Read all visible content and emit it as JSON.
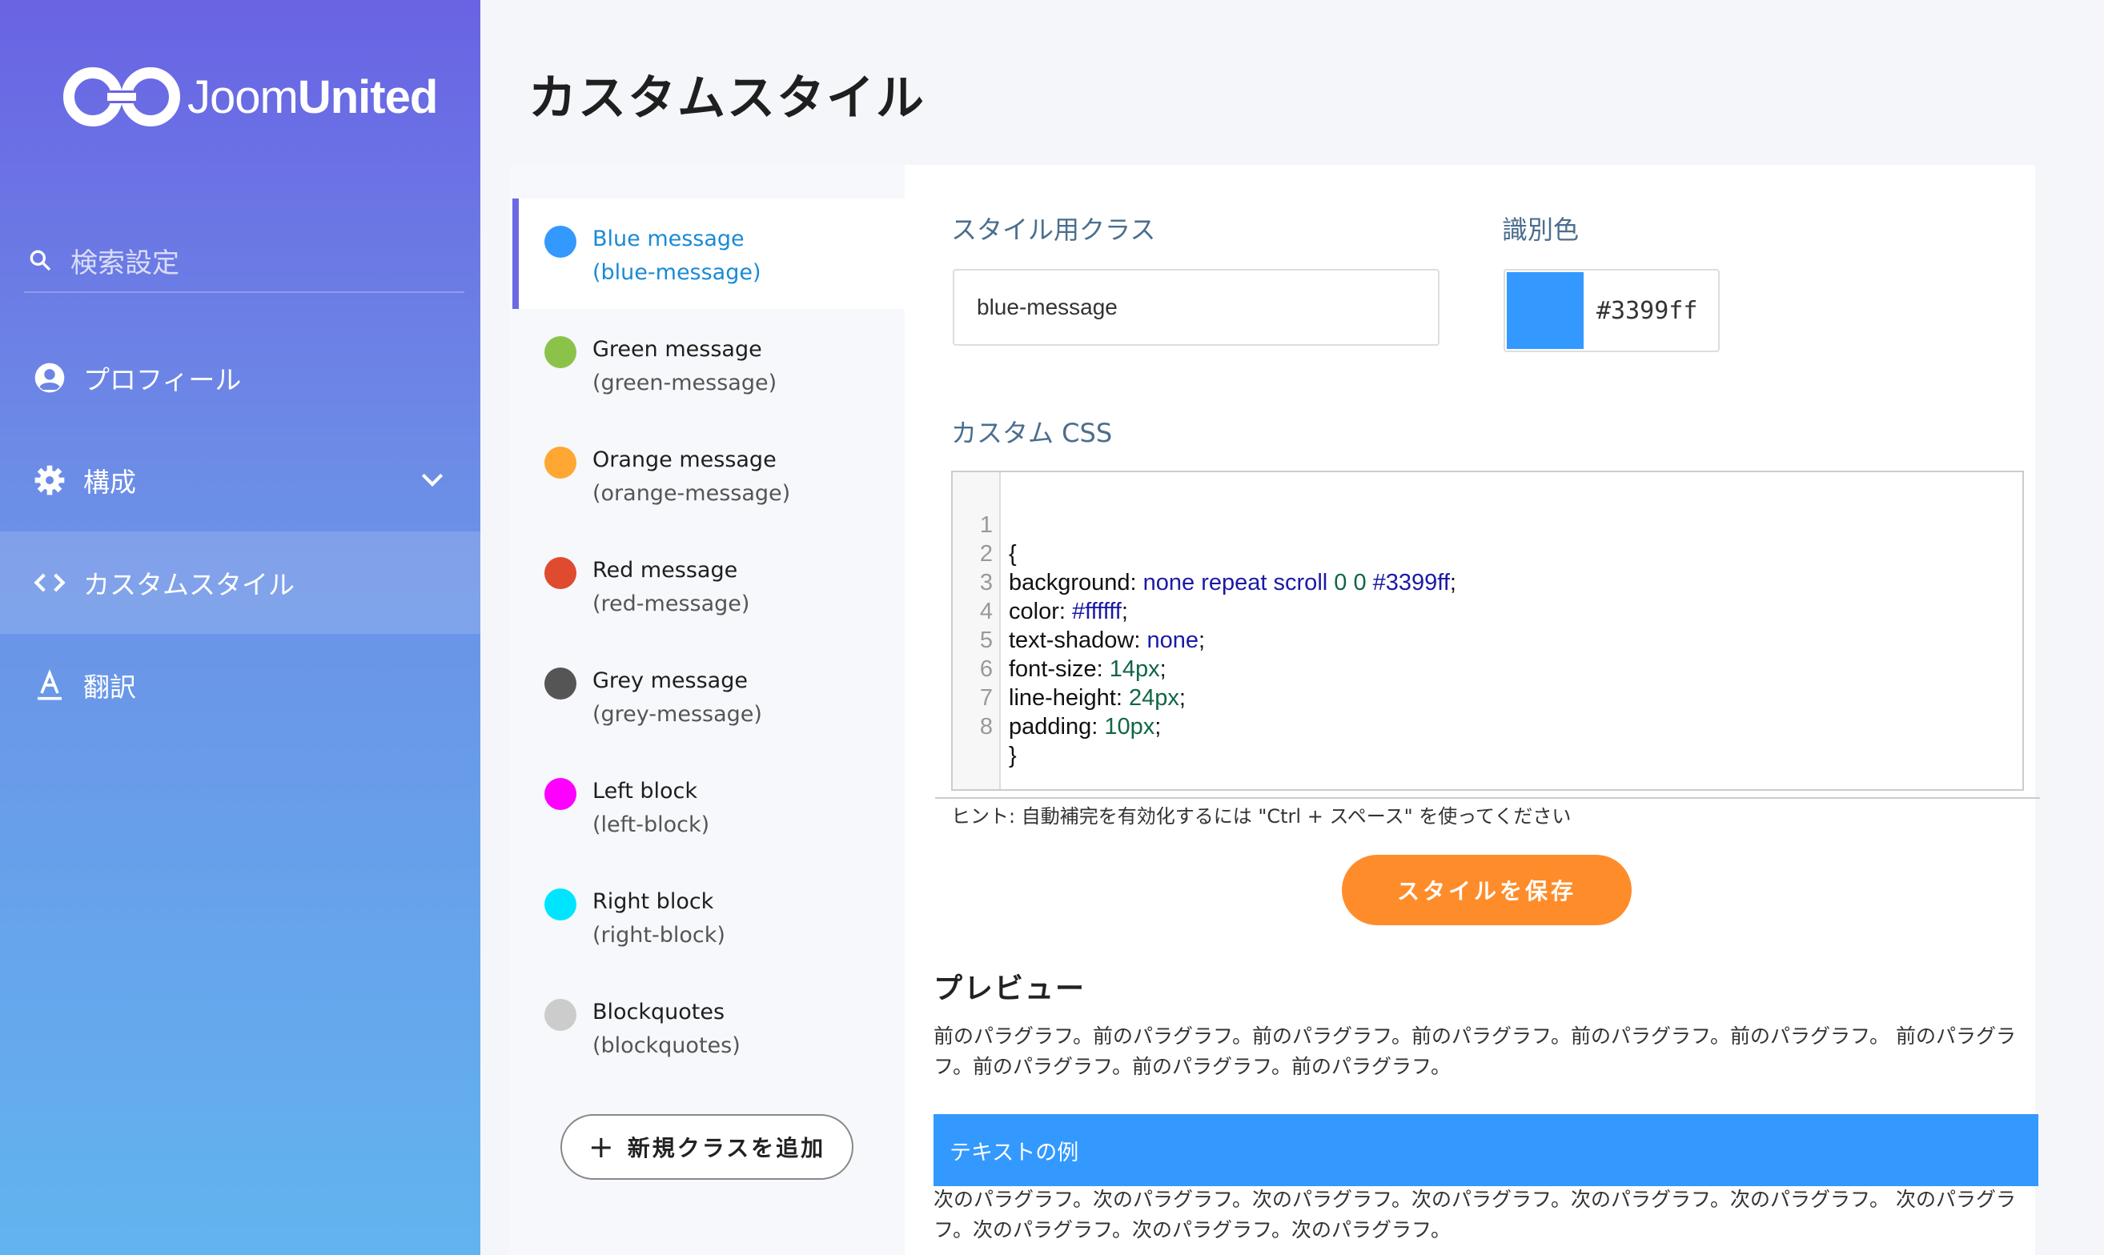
{
  "sidebar": {
    "logo": {
      "text_light": "Joom",
      "text_bold": "United"
    },
    "search_label": "検索設定",
    "items": [
      {
        "label": "プロフィール",
        "icon": "user-circle-icon"
      },
      {
        "label": "構成",
        "icon": "gear-icon"
      },
      {
        "label": "カスタムスタイル",
        "icon": "code-icon"
      },
      {
        "label": "翻訳",
        "icon": "translate-icon"
      }
    ]
  },
  "page_title": "カスタムスタイル",
  "styles_list": {
    "items": [
      {
        "name": "Blue message",
        "class": "(blue-message)",
        "color": "#3399ff"
      },
      {
        "name": "Green message",
        "class": "(green-message)",
        "color": "#8bc34a"
      },
      {
        "name": "Orange message",
        "class": "(orange-message)",
        "color": "#ffa733"
      },
      {
        "name": "Red message",
        "class": "(red-message)",
        "color": "#e04a2f"
      },
      {
        "name": "Grey message",
        "class": "(grey-message)",
        "color": "#555555"
      },
      {
        "name": "Left block",
        "class": "(left-block)",
        "color": "#ff00ff"
      },
      {
        "name": "Right block",
        "class": "(right-block)",
        "color": "#00e5ff"
      },
      {
        "name": "Blockquotes",
        "class": "(blockquotes)",
        "color": "#cccccc"
      }
    ],
    "add_button_plus": "+",
    "add_button_label": "新規クラスを追加"
  },
  "form": {
    "class_label": "スタイル用クラス",
    "class_value": "blue-message",
    "color_label": "識別色",
    "color_value": "#3399ff",
    "css_label": "カスタム CSS",
    "code_lines": [
      {
        "num": "1",
        "prop": "{",
        "val": "",
        "numpart": "",
        "tail": ""
      },
      {
        "num": "2",
        "prop": "background: ",
        "val": "none repeat scroll ",
        "numpart": "0 0 ",
        "tail": "#3399ff",
        "end": ";"
      },
      {
        "num": "3",
        "prop": "color: ",
        "val": "#ffffff",
        "numpart": "",
        "tail": "",
        "end": ";"
      },
      {
        "num": "4",
        "prop": "text-shadow: ",
        "val": "none",
        "numpart": "",
        "tail": "",
        "end": ";"
      },
      {
        "num": "5",
        "prop": "font-size: ",
        "val": "",
        "numpart": "14px",
        "tail": "",
        "end": ";"
      },
      {
        "num": "6",
        "prop": "line-height: ",
        "val": "",
        "numpart": "24px",
        "tail": "",
        "end": ";"
      },
      {
        "num": "7",
        "prop": "padding: ",
        "val": "",
        "numpart": "10px",
        "tail": "",
        "end": ";"
      },
      {
        "num": "8",
        "prop": "}",
        "val": "",
        "numpart": "",
        "tail": ""
      }
    ],
    "hint": "ヒント: 自動補完を有効化するには \"Ctrl + スペース\" を使ってください",
    "save_label": "スタイルを保存"
  },
  "preview": {
    "title": "プレビュー",
    "before_paragraph": "前のパラグラフ。前のパラグラフ。前のパラグラフ。前のパラグラフ。前のパラグラフ。前のパラグラフ。 前のパラグラフ。前のパラグラフ。前のパラグラフ。前のパラグラフ。",
    "example_text": "テキストの例",
    "after_paragraph": "次のパラグラフ。次のパラグラフ。次のパラグラフ。次のパラグラフ。次のパラグラフ。次のパラグラフ。 次のパラグラフ。次のパラグラフ。次のパラグラフ。次のパラグラフ。"
  },
  "colors": {
    "accent": "#6c6ae2",
    "save_button": "#ff8c2a",
    "example_bg": "#3399ff"
  }
}
